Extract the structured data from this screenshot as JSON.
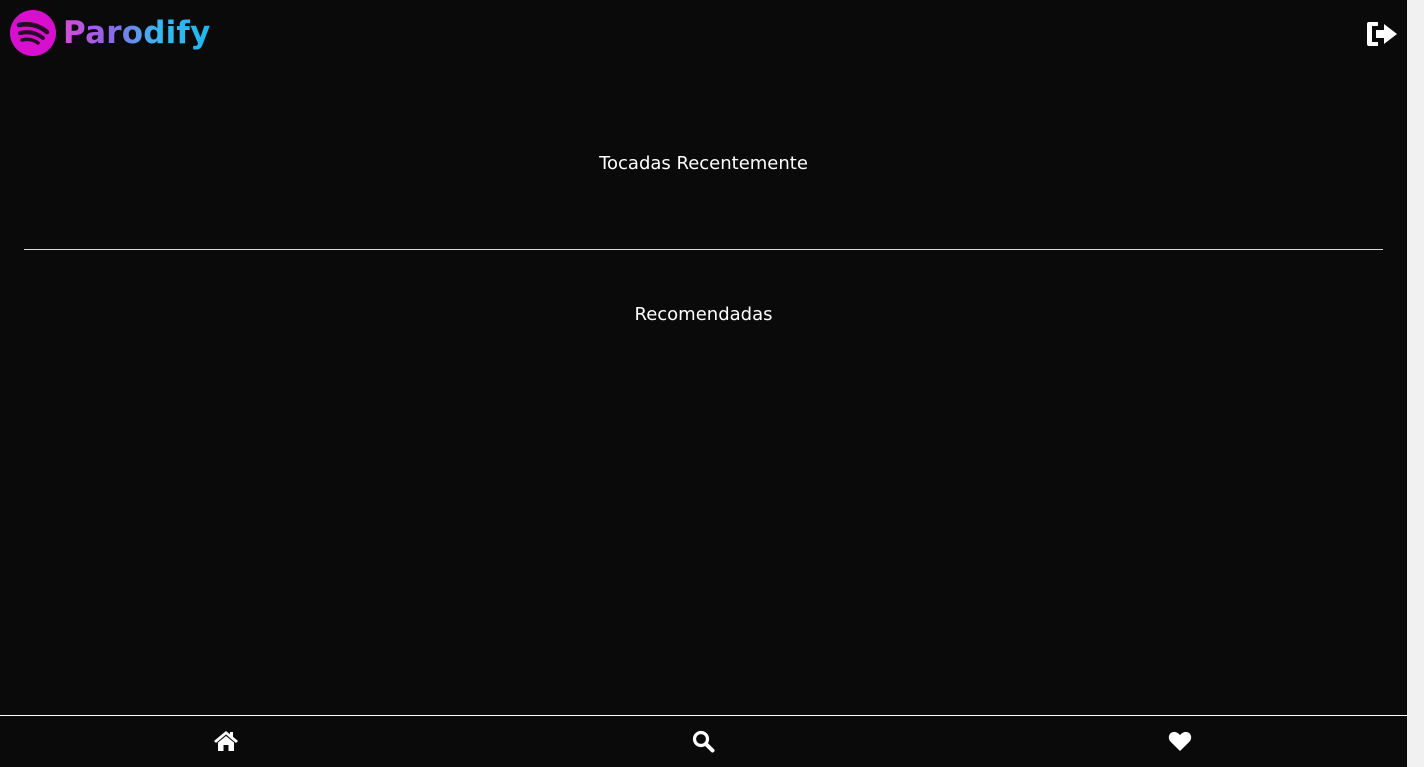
{
  "app": {
    "name": "Parodify",
    "logo_icon": "parodify-logo-icon",
    "brand_colors": {
      "logo_circle": "#d90fcf",
      "wordmark_start": "#d64bd6",
      "wordmark_end": "#1fb6ef"
    }
  },
  "header": {
    "logout_icon": "sign-out-icon"
  },
  "sections": {
    "recent": {
      "title": "Tocadas Recentemente"
    },
    "recommended": {
      "title": "Recomendadas"
    }
  },
  "bottom_nav": {
    "items": [
      {
        "id": "home",
        "icon": "home-icon"
      },
      {
        "id": "search",
        "icon": "search-icon"
      },
      {
        "id": "favorites",
        "icon": "heart-icon"
      }
    ]
  },
  "theme": {
    "background": "#0a0a0a",
    "text": "#ffffff"
  }
}
